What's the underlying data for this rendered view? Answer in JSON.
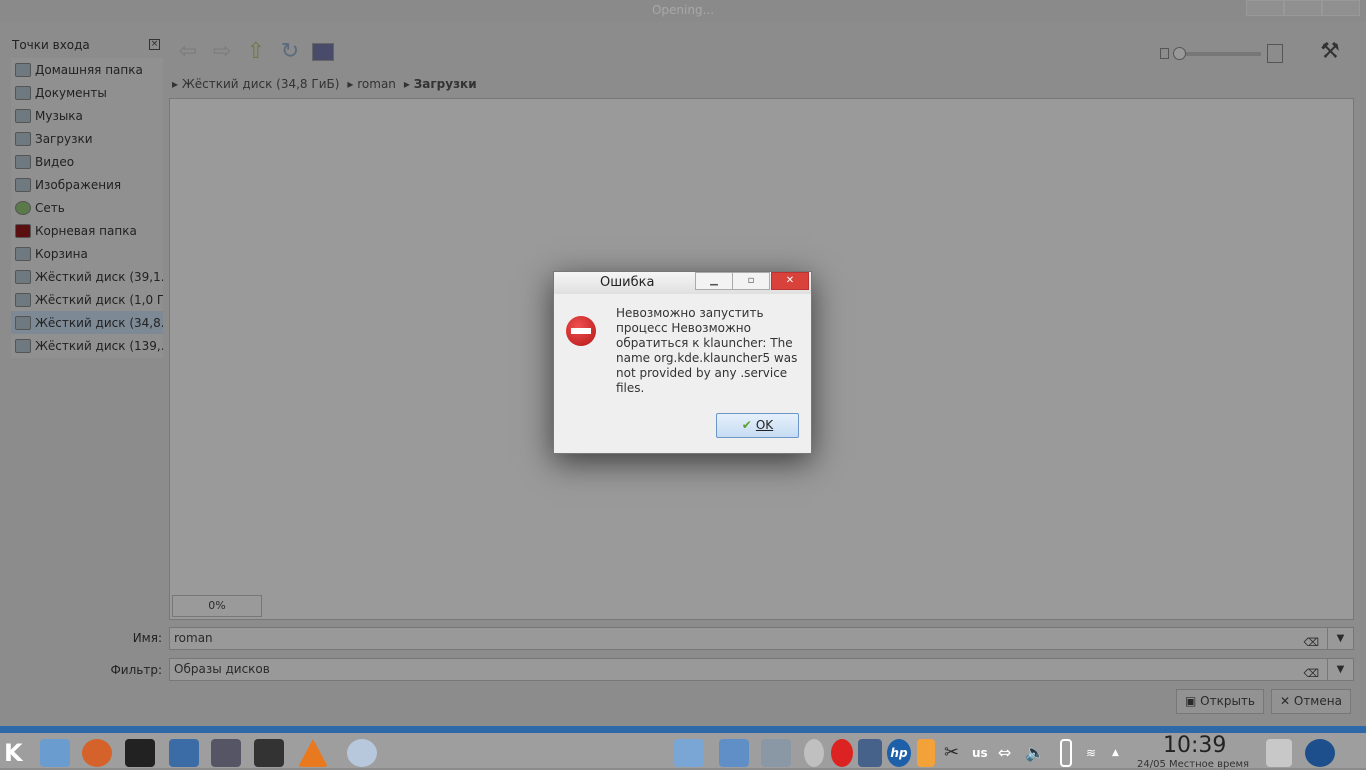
{
  "window": {
    "title": "Opening..."
  },
  "sidebar": {
    "title": "Точки входа",
    "items": [
      {
        "label": "Домашняя папка"
      },
      {
        "label": "Документы"
      },
      {
        "label": "Музыка"
      },
      {
        "label": "Загрузки"
      },
      {
        "label": "Видео"
      },
      {
        "label": "Изображения"
      },
      {
        "label": "Сеть"
      },
      {
        "label": "Корневая папка"
      },
      {
        "label": "Корзина"
      },
      {
        "label": "Жёсткий диск (39,1..."
      },
      {
        "label": "Жёсткий диск (1,0 Г..."
      },
      {
        "label": "Жёсткий диск (34,8..."
      },
      {
        "label": "Жёсткий диск (139,..."
      }
    ]
  },
  "breadcrumb": [
    "Жёсткий диск (34,8 ГиБ)",
    "roman",
    "Загрузки"
  ],
  "progress": {
    "label": "0%",
    "value": 0
  },
  "form": {
    "name_label": "Имя:",
    "name_value": "roman",
    "filter_label": "Фильтр:",
    "filter_value": "Образы дисков"
  },
  "buttons": {
    "open": "Открыть",
    "cancel": "Отмена"
  },
  "dialog": {
    "title": "Ошибка",
    "message": "Невозможно запустить процесс Невозможно обратиться к klauncher: The name org.kde.klauncher5 was not provided by any .service files.",
    "ok": "OK"
  },
  "taskbar": {
    "time": "10:39",
    "date": "24/05 Местное время",
    "keyboard": "us"
  }
}
